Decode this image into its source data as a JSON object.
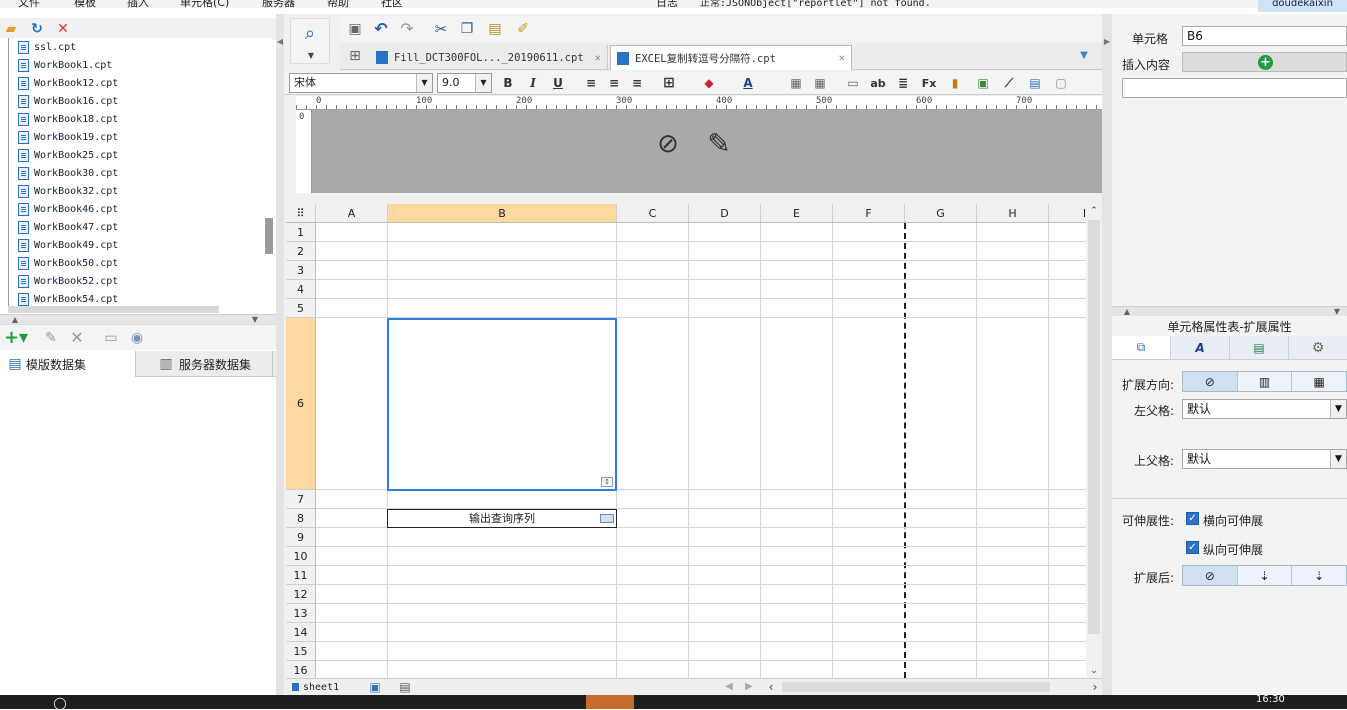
{
  "menu": {
    "items": [
      "文件",
      "模板",
      "插入",
      "单元格(C)",
      "服务器",
      "帮助",
      "社区"
    ],
    "log": "日志",
    "status": "正常:JSONObject[\"reportlet\"] not found.",
    "user": "doudekaixin"
  },
  "file_tree": {
    "items": [
      "ssl.cpt",
      "WorkBook1.cpt",
      "WorkBook12.cpt",
      "WorkBook16.cpt",
      "WorkBook18.cpt",
      "WorkBook19.cpt",
      "WorkBook25.cpt",
      "WorkBook30.cpt",
      "WorkBook32.cpt",
      "WorkBook46.cpt",
      "WorkBook47.cpt",
      "WorkBook49.cpt",
      "WorkBook50.cpt",
      "WorkBook52.cpt",
      "WorkBook54.cpt"
    ]
  },
  "dataset_tabs": {
    "template": "模版数据集",
    "server": "服务器数据集"
  },
  "doc_tabs": [
    {
      "label": "Fill_DCT300FOL..._20190611.cpt"
    },
    {
      "label": "EXCEL复制转逗号分隔符.cpt"
    }
  ],
  "format": {
    "font": "宋体",
    "size": "9.0"
  },
  "ruler": {
    "marks": [
      "0",
      "100",
      "200",
      "300",
      "400",
      "500",
      "600",
      "700"
    ],
    "v_mark": "0"
  },
  "grid": {
    "columns": [
      "A",
      "B",
      "C",
      "D",
      "E",
      "F",
      "G",
      "H",
      "I"
    ],
    "rows": [
      "1",
      "2",
      "3",
      "4",
      "5",
      "6",
      "7",
      "8",
      "9",
      "10",
      "11",
      "12",
      "13",
      "14",
      "15",
      "16"
    ],
    "cell_b8": "输出查询序列"
  },
  "sheet": {
    "name": "sheet1"
  },
  "right_panel": {
    "cell_label": "单元格",
    "cell_value": "B6",
    "insert_label": "插入内容",
    "props_title": "单元格属性表-扩展属性",
    "expand_dir_label": "扩展方向:",
    "left_parent_label": "左父格:",
    "left_parent_value": "默认",
    "top_parent_label": "上父格:",
    "top_parent_value": "默认",
    "stretch_label": "可伸展性:",
    "stretch_h": "横向可伸展",
    "stretch_v": "纵向可伸展",
    "after_expand_label": "扩展后:"
  },
  "taskbar": {
    "time": "16:30"
  },
  "colors": {
    "selected_col": "#fdd9a1",
    "selection_border": "#2f7be0",
    "toolbar_bg": "#f4f4f4"
  }
}
